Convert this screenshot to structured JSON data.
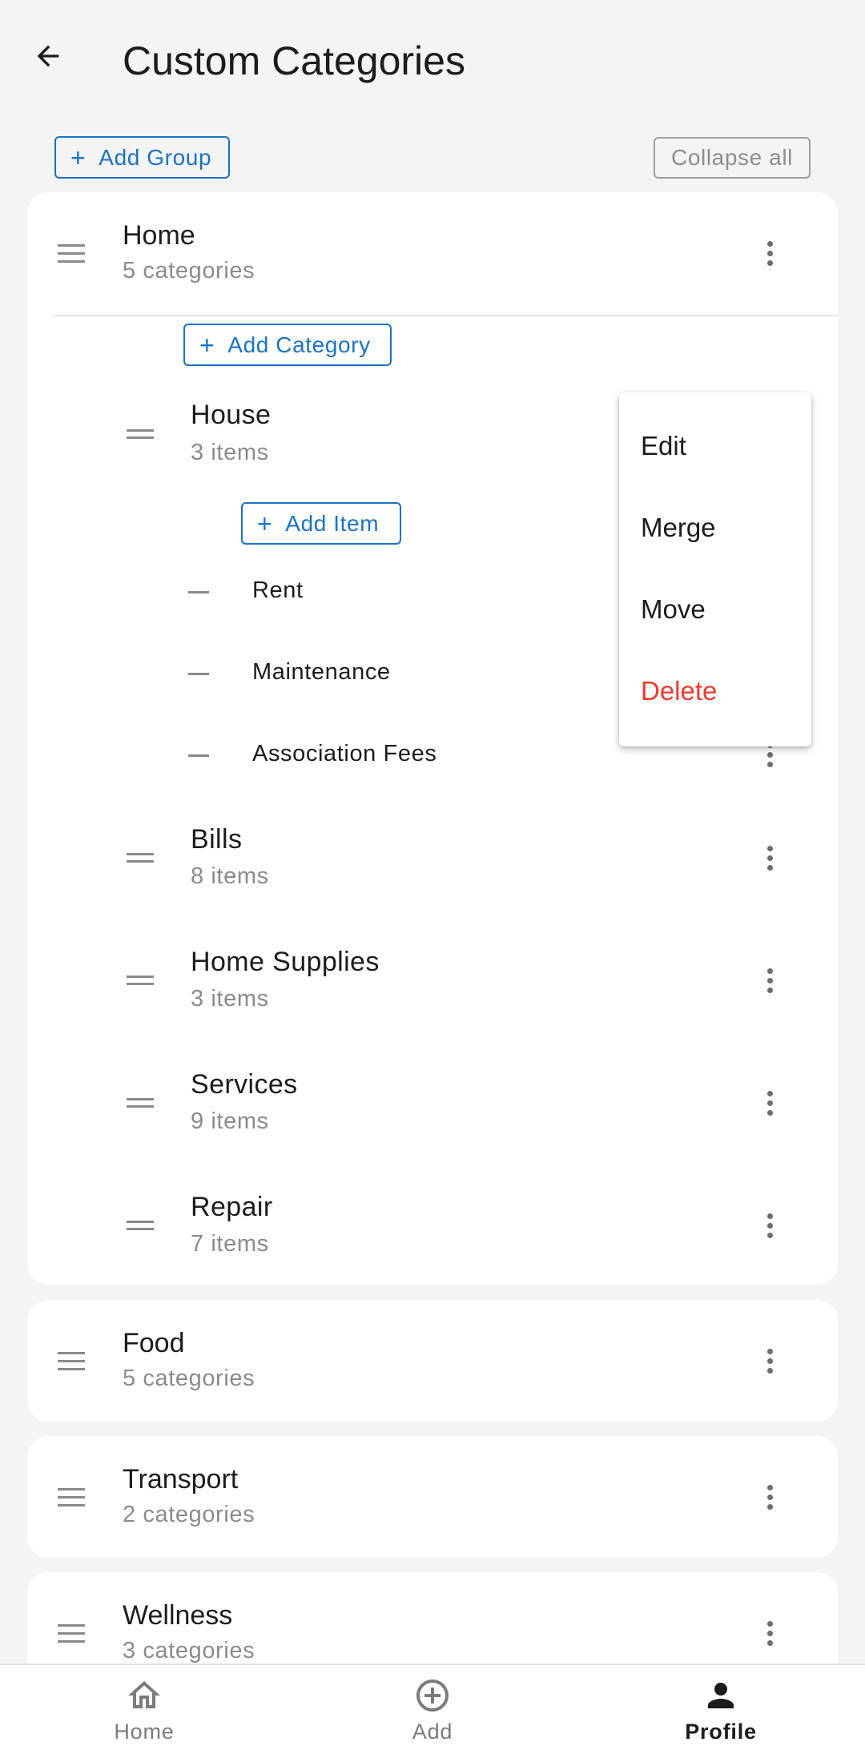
{
  "header": {
    "title": "Custom Categories"
  },
  "toolbar": {
    "add_group_label": "Add Group",
    "collapse_label": "Collapse all"
  },
  "groups": [
    {
      "title": "Home",
      "subtitle": "5 categories",
      "add_category_label": "Add Category",
      "categories": [
        {
          "title": "House",
          "subtitle": "3 items",
          "add_item_label": "Add Item",
          "items": [
            "Rent",
            "Maintenance",
            "Association Fees"
          ]
        },
        {
          "title": "Bills",
          "subtitle": "8 items"
        },
        {
          "title": "Home Supplies",
          "subtitle": "3 items"
        },
        {
          "title": "Services",
          "subtitle": "9 items"
        },
        {
          "title": "Repair",
          "subtitle": "7 items"
        }
      ]
    },
    {
      "title": "Food",
      "subtitle": "5 categories"
    },
    {
      "title": "Transport",
      "subtitle": "2 categories"
    },
    {
      "title": "Wellness",
      "subtitle": "3 categories"
    }
  ],
  "context_menu": {
    "items": [
      "Edit",
      "Merge",
      "Move",
      "Delete"
    ],
    "danger_color": "#f0392d"
  },
  "bottom_nav": {
    "items": [
      "Home",
      "Add",
      "Profile"
    ],
    "active": "Profile"
  },
  "colors": {
    "accent": "#1a73c4",
    "background": "#f4f4f4"
  }
}
